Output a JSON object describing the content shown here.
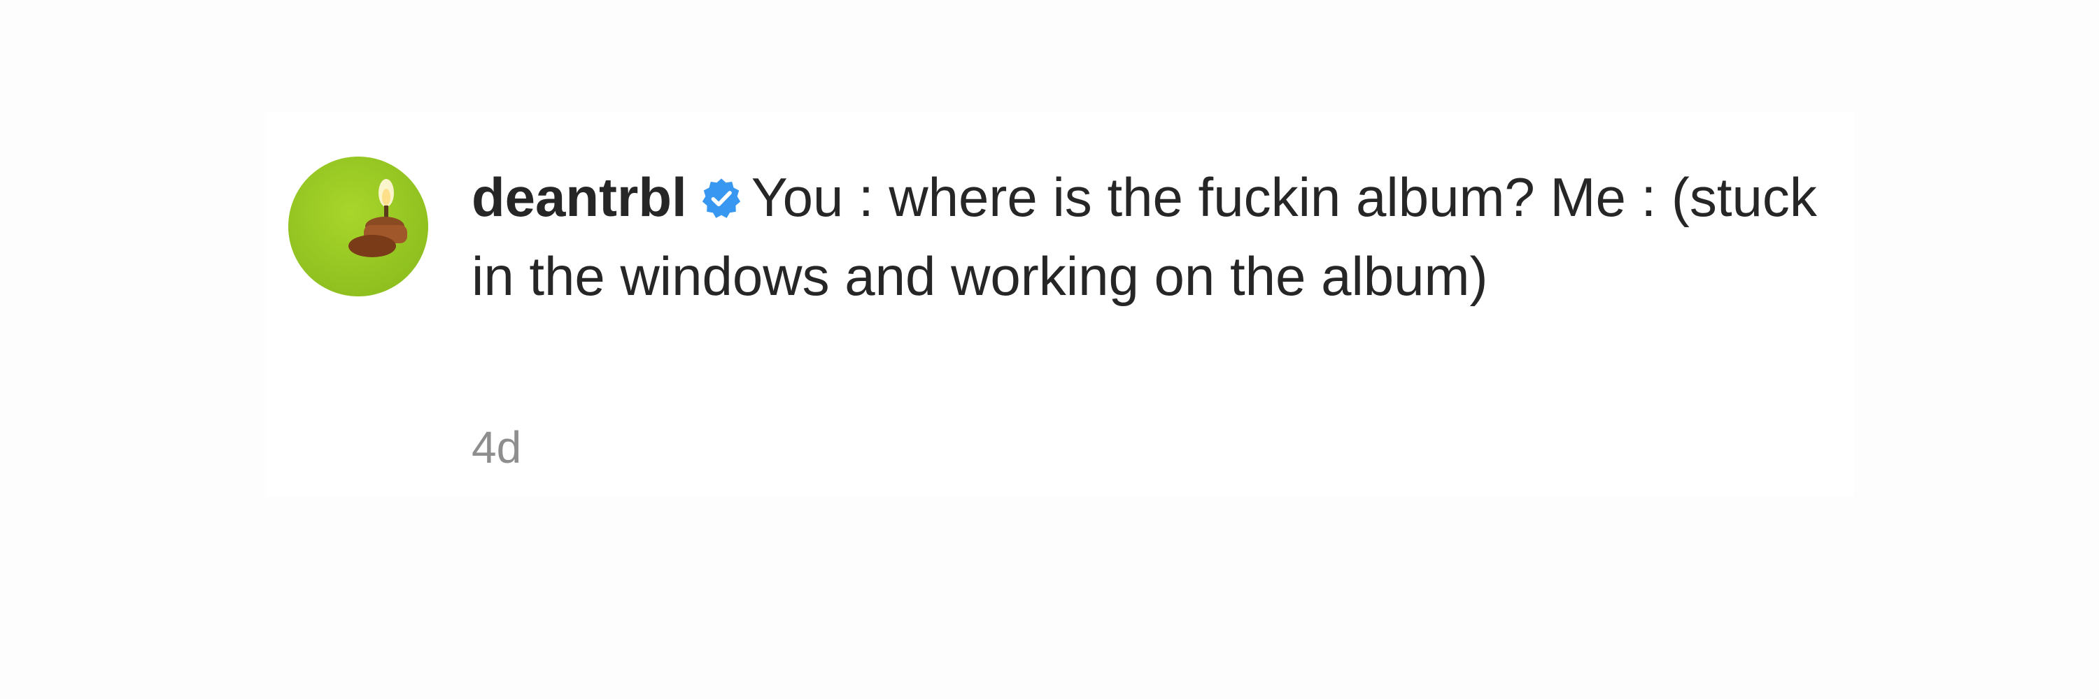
{
  "comment": {
    "username": "deantrbl",
    "verified_icon": "verified-badge-icon",
    "text": "You : where is the fuckin album? Me : (stuck in the windows and working on the album)",
    "timestamp": "4d"
  },
  "avatar": {
    "icon": "candle-flame-icon",
    "background_color": "#94c522"
  },
  "colors": {
    "text": "#262626",
    "muted": "#8e8e8e",
    "verified": "#3897f0"
  }
}
